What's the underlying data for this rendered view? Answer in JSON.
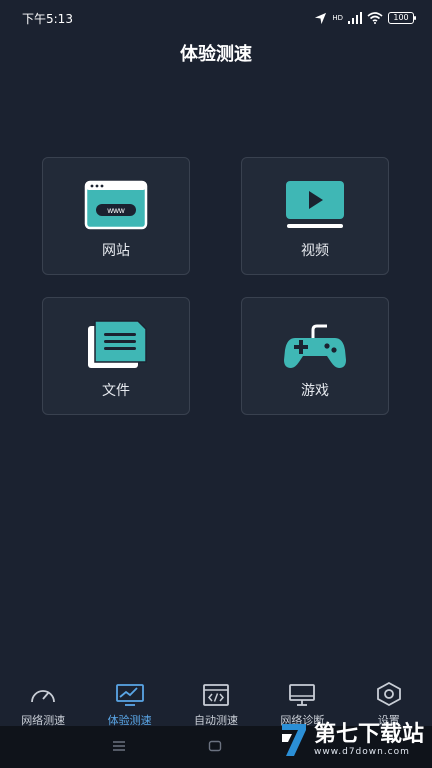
{
  "status_bar": {
    "time": "下午5:13",
    "network": "HD",
    "battery": "100"
  },
  "page": {
    "title": "体验测速"
  },
  "cards": {
    "website": {
      "label": "网站",
      "icon": "website-icon"
    },
    "video": {
      "label": "视频",
      "icon": "video-icon"
    },
    "file": {
      "label": "文件",
      "icon": "file-icon"
    },
    "game": {
      "label": "游戏",
      "icon": "gamepad-icon"
    }
  },
  "tabs": [
    {
      "label": "网络测速",
      "icon": "speedometer-icon",
      "active": false
    },
    {
      "label": "体验测速",
      "icon": "chart-icon",
      "active": true
    },
    {
      "label": "自动测速",
      "icon": "code-icon",
      "active": false
    },
    {
      "label": "网络诊断",
      "icon": "monitor-icon",
      "active": false
    },
    {
      "label": "设置",
      "icon": "settings-icon",
      "active": false
    }
  ],
  "watermark": {
    "main": "第七下载站",
    "sub": "www.d7down.com"
  },
  "colors": {
    "background": "#1b2230",
    "accent": "#3fb7b5",
    "active_tab": "#5aa6e6"
  }
}
